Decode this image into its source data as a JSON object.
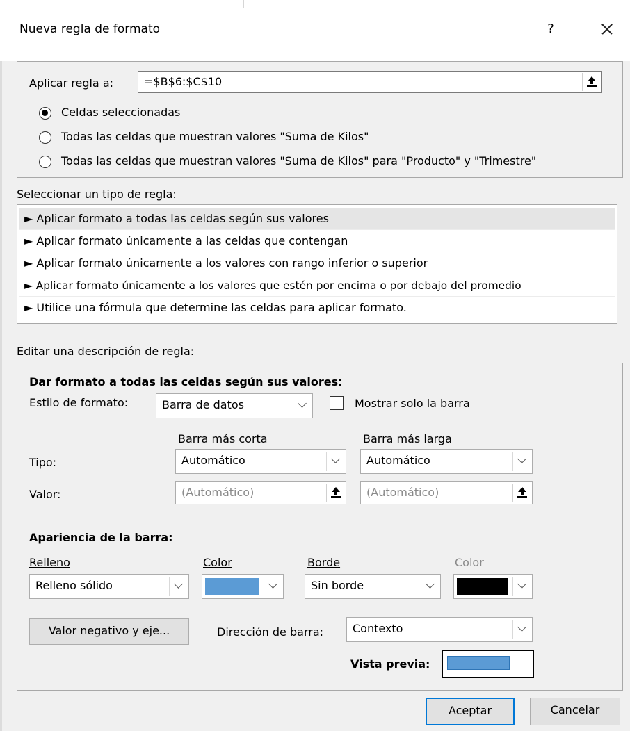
{
  "dialog": {
    "title": "Nueva regla de formato",
    "help_label": "?",
    "close_label": "✕"
  },
  "apply_rule": {
    "label": "Aplicar regla a:",
    "value": "=$B$6:$C$10",
    "options": [
      {
        "label": "Celdas seleccionadas",
        "selected": true
      },
      {
        "label": "Todas las celdas que muestran valores \"Suma de Kilos\"",
        "selected": false
      },
      {
        "label": "Todas las celdas que muestran valores \"Suma de Kilos\" para \"Producto\" y \"Trimestre\"",
        "selected": false
      }
    ]
  },
  "rule_type": {
    "label": "Seleccionar un tipo de regla:",
    "items": [
      "► Aplicar formato a todas las celdas según sus valores",
      "► Aplicar formato únicamente a las celdas que contengan",
      "► Aplicar formato únicamente a los valores con rango inferior o superior",
      "► Aplicar formato únicamente a los valores que estén por encima o por debajo del promedio",
      "► Utilice una fórmula que determine las celdas para aplicar formato."
    ],
    "selected_index": 0
  },
  "rule_description": {
    "label": "Editar una descripción de regla:",
    "heading": "Dar formato a todas las celdas según sus valores:",
    "format_style_label": "Estilo de formato:",
    "format_style_value": "Barra de datos",
    "show_bar_only_label": "Mostrar solo la barra",
    "show_bar_only_checked": false,
    "shortest_bar_label": "Barra más corta",
    "longest_bar_label": "Barra más larga",
    "type_label": "Tipo:",
    "value_label": "Valor:",
    "shortest_type": "Automático",
    "longest_type": "Automático",
    "shortest_value": "(Automático)",
    "longest_value": "(Automático)"
  },
  "bar_appearance": {
    "heading": "Apariencia de la barra:",
    "fill_label": "Relleno",
    "fill_value": "Relleno sólido",
    "fill_color_label": "Color",
    "fill_color": "#5b9bd5",
    "border_label": "Borde",
    "border_value": "Sin borde",
    "border_color_label": "Color",
    "border_color": "#000000",
    "negative_button": "Valor negativo y eje...",
    "direction_label": "Dirección de barra:",
    "direction_value": "Contexto",
    "preview_label": "Vista previa:"
  },
  "buttons": {
    "ok": "Aceptar",
    "cancel": "Cancelar"
  }
}
